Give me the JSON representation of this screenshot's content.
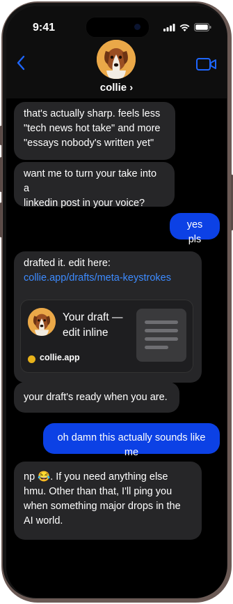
{
  "status_bar": {
    "time": "9:41"
  },
  "header": {
    "contact_name": "collie ›"
  },
  "messages": {
    "m1": {
      "line1": "that's actually sharp. feels less",
      "line2": "\"tech news hot take\" and more",
      "line3": "\"essays nobody's written yet\""
    },
    "m2": {
      "line1": "want me to turn your take into a",
      "line2": "linkedin post in your voice?"
    },
    "m3": {
      "text": "yes pls"
    },
    "m4": {
      "text": "drafted it. edit here:",
      "link": "collie.app/drafts/meta-keystrokes"
    },
    "card": {
      "title_line1": "Your draft —",
      "title_line2": "edit inline",
      "site": "collie.app"
    },
    "m5": {
      "text": "your draft's ready when you are."
    },
    "m6": {
      "text": "oh damn this actually sounds like me"
    },
    "m7": {
      "line1": "np 😂. If you need anything else",
      "line2": "hmu. Other than that, I'll ping you",
      "line3": "when something major drops in the",
      "line4": "AI world."
    }
  },
  "colors": {
    "outgoing_bubble": "#0c41e5",
    "incoming_bubble": "#262628",
    "accent": "#1e66ff",
    "link": "#3d8bff"
  },
  "icons": {
    "back": "chevron-left-icon",
    "video": "video-camera-icon",
    "signal": "signal-icon",
    "wifi": "wifi-icon",
    "battery": "battery-icon"
  }
}
